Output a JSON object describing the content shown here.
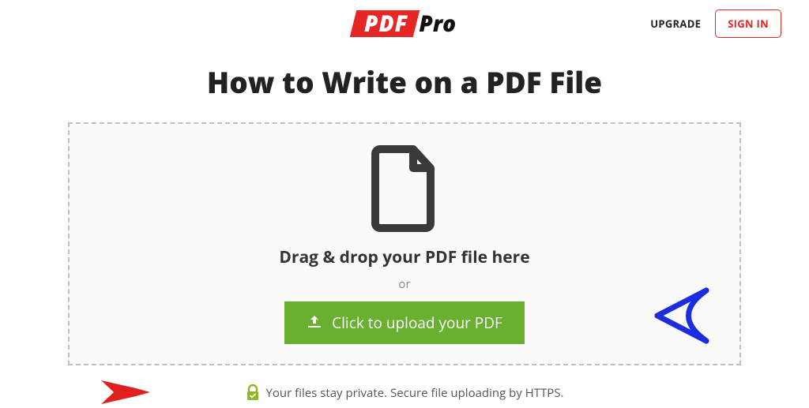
{
  "logo": {
    "pdf": "PDF",
    "pro": "Pro"
  },
  "header": {
    "upgrade": "UPGRADE",
    "signin": "SIGN IN"
  },
  "title": "How to Write on a PDF File",
  "dropzone": {
    "drag_text": "Drag & drop your PDF file here",
    "or": "or",
    "upload_label": "Click to upload your PDF"
  },
  "privacy": "Your files stay private. Secure file uploading by HTTPS.",
  "colors": {
    "brand_red": "#e52625",
    "accent_green": "#69b030",
    "blue_arrow": "#1a2de0"
  }
}
